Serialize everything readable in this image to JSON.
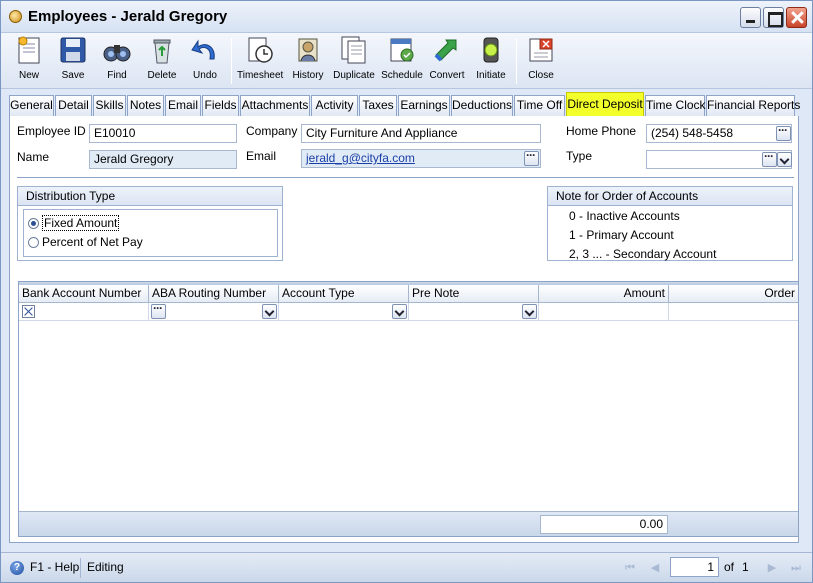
{
  "window": {
    "title": "Employees - Jerald Gregory"
  },
  "toolbar": {
    "new": "New",
    "save": "Save",
    "find": "Find",
    "delete": "Delete",
    "undo": "Undo",
    "timesheet": "Timesheet",
    "history": "History",
    "duplicate": "Duplicate",
    "schedule": "Schedule",
    "convert": "Convert",
    "initiate": "Initiate",
    "close": "Close"
  },
  "tabs": [
    "General",
    "Detail",
    "Skills",
    "Notes",
    "Email",
    "Fields",
    "Attachments",
    "Activity",
    "Taxes",
    "Earnings",
    "Deductions",
    "Time Off",
    "Direct Deposit",
    "Time Clock",
    "Financial Reports"
  ],
  "active_tab": "Direct Deposit",
  "form": {
    "employee_id_label": "Employee ID",
    "employee_id": "E10010",
    "name_label": "Name",
    "name": "Jerald Gregory",
    "company_label": "Company",
    "company": "City Furniture And Appliance",
    "email_label": "Email",
    "email": "jerald_g@cityfa.com",
    "home_phone_label": "Home Phone",
    "home_phone": "(254) 548-5458",
    "type_label": "Type",
    "type": ""
  },
  "distribution": {
    "title": "Distribution Type",
    "options": [
      "Fixed Amount",
      "Percent of Net Pay"
    ],
    "selected": "Fixed Amount"
  },
  "note": {
    "title": "Note for Order of Accounts",
    "lines": [
      "0 - Inactive Accounts",
      "1 - Primary Account",
      "2, 3 ... - Secondary Account"
    ]
  },
  "grid": {
    "columns": [
      "Bank Account Number",
      "ABA Routing Number",
      "Account Type",
      "Pre Note",
      "Amount",
      "Order"
    ],
    "total": "0.00"
  },
  "statusbar": {
    "help": "F1 - Help",
    "mode": "Editing",
    "page": "1",
    "of_label": "of",
    "page_count": "1"
  },
  "colors": {
    "accent": "#1f4d9e",
    "active_tab": "#f3ff2a",
    "panel_bg": "#dfe8f6"
  }
}
